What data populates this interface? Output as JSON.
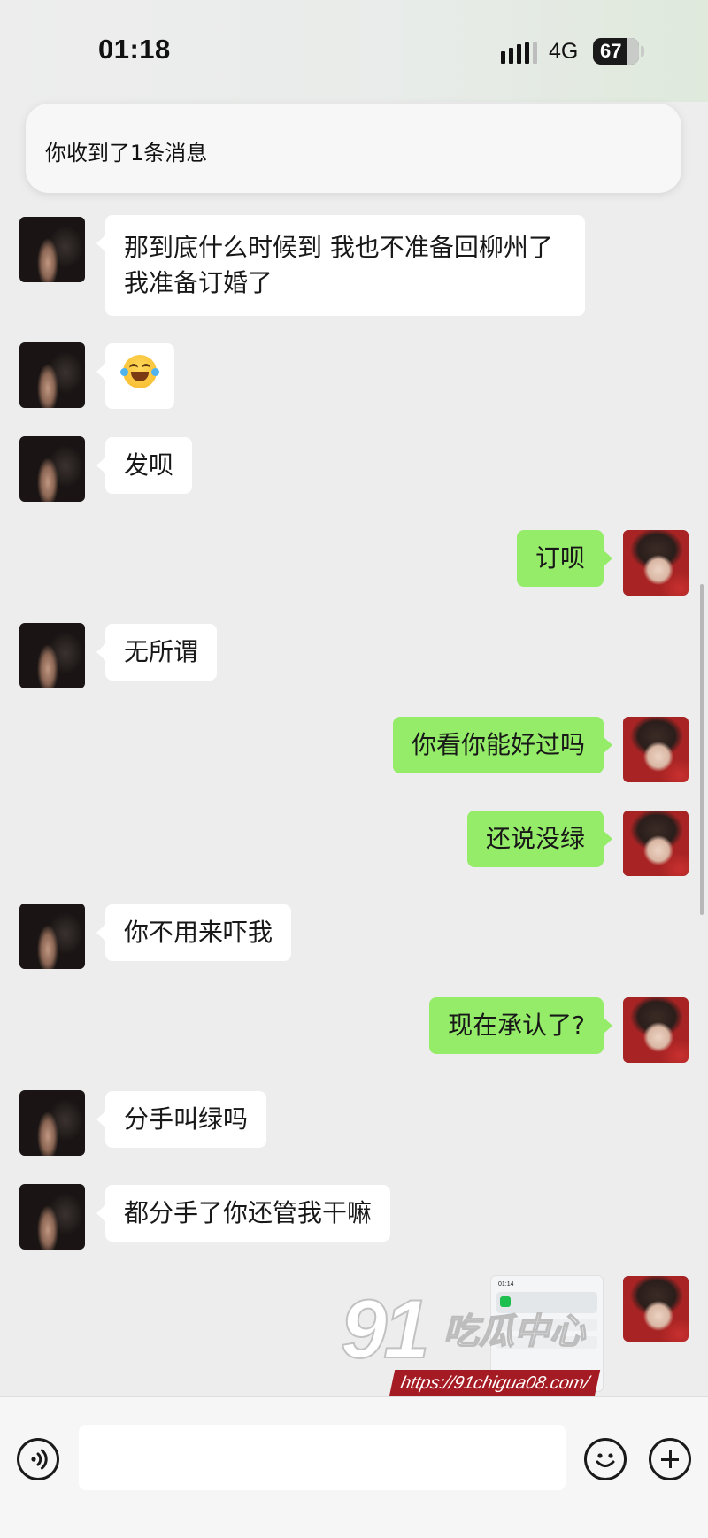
{
  "status_bar": {
    "time": "01:18",
    "network": "4G",
    "battery": "67"
  },
  "notification": {
    "text": "你收到了1条消息"
  },
  "messages": [
    {
      "side": "in",
      "text": "那到底什么时候到 我也不准备回柳州了 我准备订婚了"
    },
    {
      "side": "in",
      "emoji": "laughing-with-tears"
    },
    {
      "side": "in",
      "text": "发呗"
    },
    {
      "side": "out",
      "text": "订呗"
    },
    {
      "side": "in",
      "text": "无所谓"
    },
    {
      "side": "out",
      "text": "你看你能好过吗"
    },
    {
      "side": "out",
      "text": "还说没绿"
    },
    {
      "side": "in",
      "text": "你不用来吓我"
    },
    {
      "side": "out",
      "text": "现在承认了?"
    },
    {
      "side": "in",
      "text": "分手叫绿吗"
    },
    {
      "side": "in",
      "text": "都分手了你还管我干嘛"
    },
    {
      "side": "out",
      "image": "screenshot-thumbnail",
      "image_time": "01:14"
    }
  ],
  "watermark": {
    "number": "91",
    "brand": "吃瓜中心",
    "url": "https://91chigua08.com/"
  },
  "input_bar": {
    "value": "",
    "placeholder": ""
  },
  "colors": {
    "background": "#ededed",
    "incoming_bubble": "#ffffff",
    "outgoing_bubble": "#95ec69"
  }
}
